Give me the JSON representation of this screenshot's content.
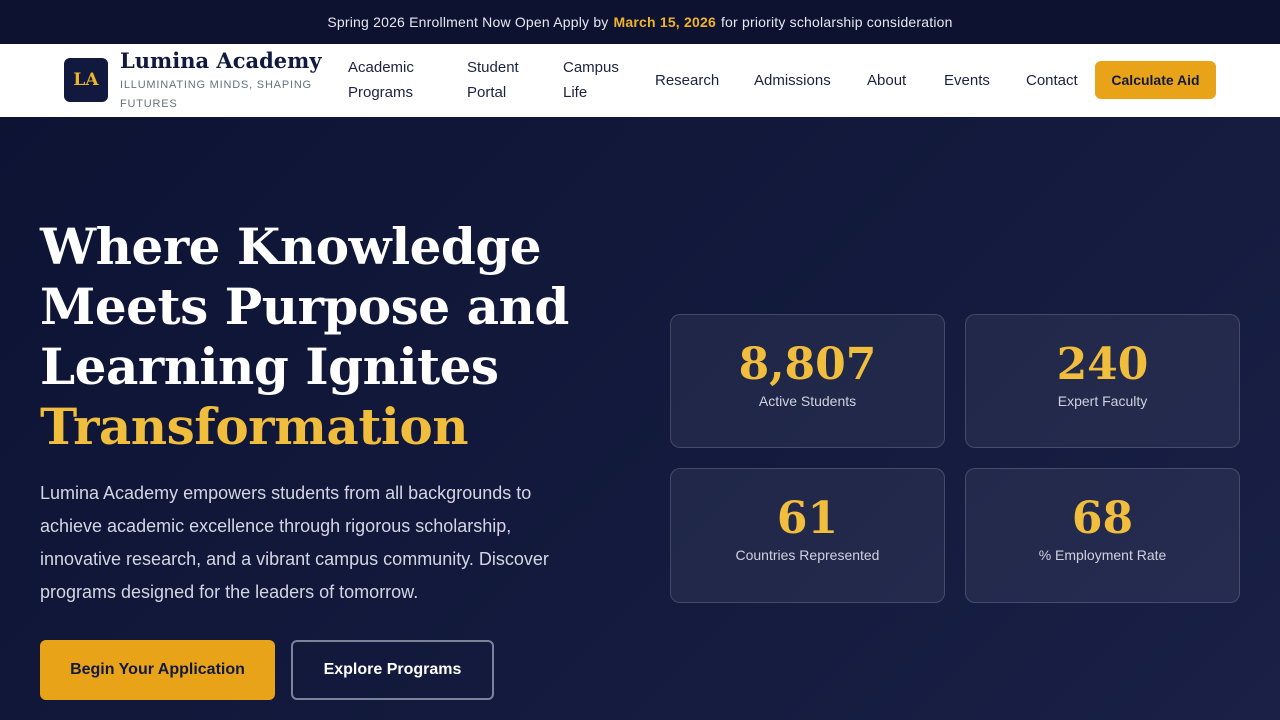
{
  "announcement": {
    "prefix": "Spring 2026 Enrollment Now Open Apply by",
    "highlight": "March 15, 2026",
    "suffix": "for priority scholarship consideration"
  },
  "brand": {
    "logo_text": "LA",
    "name": "Lumina Academy",
    "tagline": "ILLUMINATING MINDS, SHAPING FUTURES"
  },
  "nav": {
    "items": [
      "Academic Programs",
      "Student Portal",
      "Campus Life",
      "Research",
      "Admissions",
      "About",
      "Events",
      "Contact"
    ],
    "cta": "Calculate Aid"
  },
  "hero": {
    "headline_white": "Where Knowledge Meets Purpose and Learning Ignites",
    "headline_accent": "Transformation",
    "description": "Lumina Academy empowers students from all backgrounds to achieve academic excellence through rigorous scholarship, innovative research, and a vibrant campus community. Discover programs designed for the leaders of tomorrow.",
    "primary_cta": "Begin Your Application",
    "secondary_cta": "Explore Programs"
  },
  "stats": [
    {
      "value": "8,807",
      "label": "Active Students"
    },
    {
      "value": "240",
      "label": "Expert Faculty"
    },
    {
      "value": "61",
      "label": "Countries Represented"
    },
    {
      "value": "68",
      "label": "% Employment Rate"
    }
  ],
  "colors": {
    "navy": "#111a3e",
    "gold": "#e9a319",
    "gold_text": "#f0be3c"
  }
}
